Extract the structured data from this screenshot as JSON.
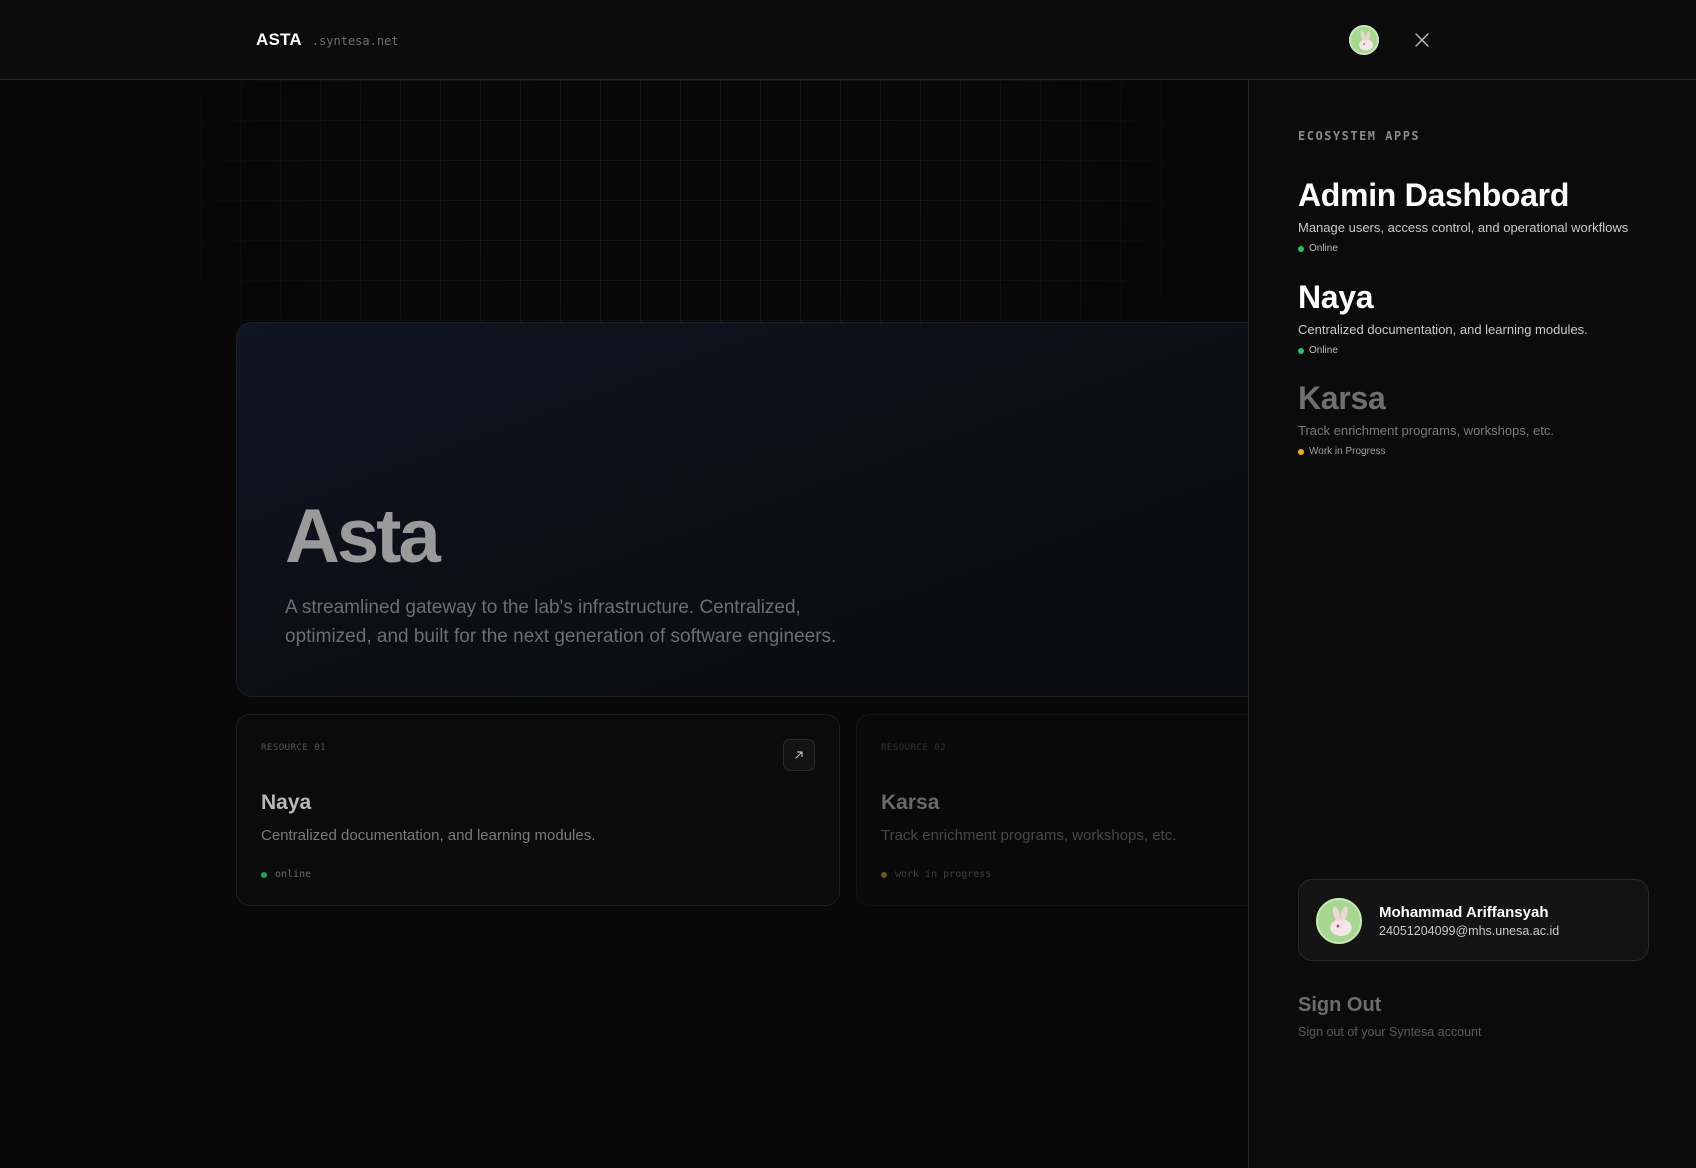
{
  "header": {
    "brand": "ASTA",
    "domain": ".syntesa.net"
  },
  "hero": {
    "title": "Asta",
    "description": "A streamlined gateway to the lab's infrastructure. Centralized, optimized, and built for the next generation of software engineers."
  },
  "resources": [
    {
      "label": "RESOURCE 01",
      "title": "Naya",
      "description": "Centralized documentation, and learning modules.",
      "status": "online",
      "status_color": "#22a04a"
    },
    {
      "label": "RESOURCE 02",
      "title": "Karsa",
      "description": "Track enrichment programs, workshops, etc.",
      "status": "work in progress",
      "status_color": "#c9972a"
    }
  ],
  "panel": {
    "heading": "ECOSYSTEM APPS",
    "apps": [
      {
        "title": "Admin Dashboard",
        "description": "Manage users, access control, and operational workflows",
        "status": "Online",
        "status_color": "#22c55e"
      },
      {
        "title": "Naya",
        "description": "Centralized documentation, and learning modules.",
        "status": "Online",
        "status_color": "#22c55e"
      },
      {
        "title": "Karsa",
        "description": "Track enrichment programs, workshops, etc.",
        "status": "Work in Progress",
        "status_color": "#eab308"
      }
    ],
    "user": {
      "name": "Mohammad Ariffansyah",
      "email": "24051204099@mhs.unesa.ac.id"
    },
    "signout": {
      "title": "Sign Out",
      "description": "Sign out of your Syntesa account"
    }
  },
  "icons": {
    "close": "close-icon",
    "external": "arrow-up-right-icon",
    "avatar": "rabbit-avatar"
  }
}
